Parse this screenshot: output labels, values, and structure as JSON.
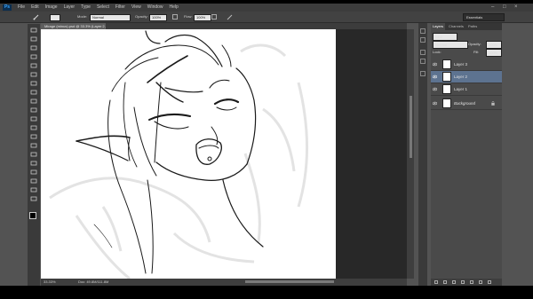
{
  "app": {
    "logo": "Ps"
  },
  "menu": [
    "File",
    "Edit",
    "Image",
    "Layer",
    "Type",
    "Select",
    "Filter",
    "View",
    "Window",
    "Help"
  ],
  "options": {
    "mode_label": "Mode:",
    "mode_value": "Normal",
    "opacity_label": "Opacity:",
    "opacity_value": "100%",
    "flow_label": "Flow:",
    "flow_value": "100%"
  },
  "workspace": {
    "label": "Essentials"
  },
  "document": {
    "tab_title": "Mirage (minus).psd @ 33.3% (Layer 2, RGB/8) *",
    "zoom": "33.33%",
    "doc_info": "Doc: 49.8M/111.8M"
  },
  "layers_panel": {
    "tabs": [
      "Layers",
      "Channels",
      "Paths"
    ],
    "kind_label": "Kind",
    "blend_mode": "Normal",
    "opacity_label": "Opacity:",
    "opacity_value": "100%",
    "lock_label": "Lock:",
    "fill_label": "Fill:",
    "fill_value": "100%",
    "layers": [
      {
        "name": "Layer 3"
      },
      {
        "name": "Layer 2"
      },
      {
        "name": "Layer 1"
      },
      {
        "name": "Background"
      }
    ]
  },
  "colors": {
    "ui_bg": "#535353",
    "panel": "#4a4a4a",
    "selected_layer": "#5d7390",
    "canvas": "#ffffff"
  },
  "icons": [
    "brush-icon",
    "eye-icon",
    "lock-icon",
    "minimize-icon",
    "maximize-icon",
    "close-icon"
  ]
}
